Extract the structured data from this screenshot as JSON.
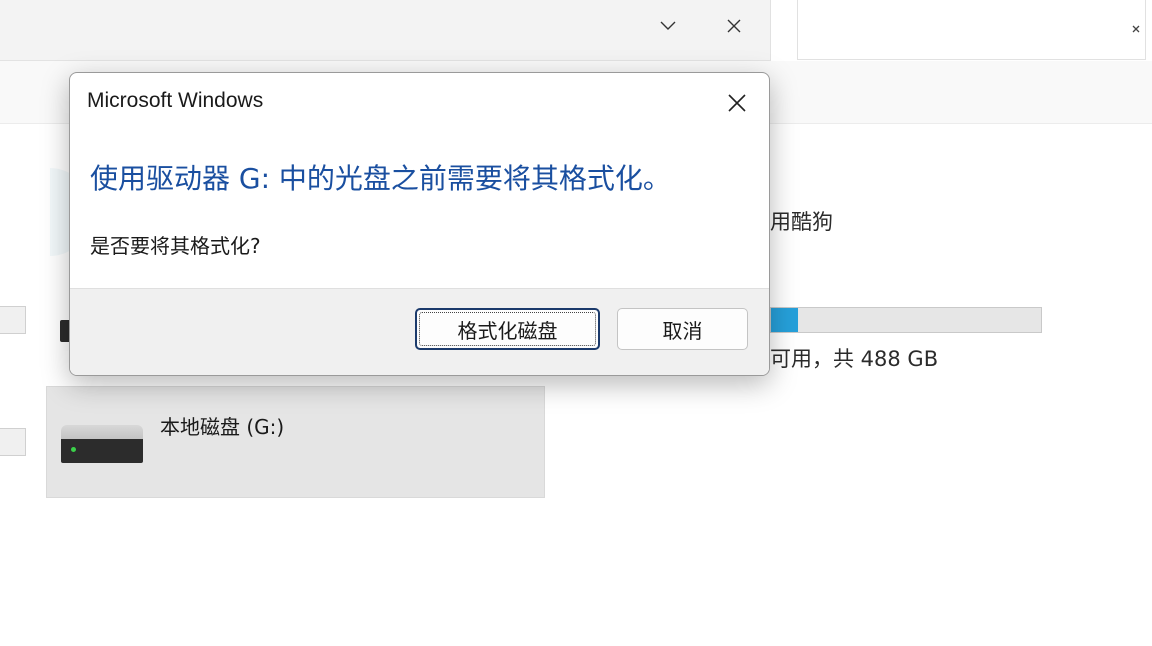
{
  "window_controls": {
    "minimize_glyph": "⌄",
    "close_glyph": "✕"
  },
  "explorer": {
    "drive_g_name": "本地磁盘 (G:)",
    "right_label_partial": "用酷狗",
    "usage_text_partial": "可用，共 488 GB",
    "usage_fraction": 0.1
  },
  "dialog": {
    "title": "Microsoft Windows",
    "main_instruction": "使用驱动器 G: 中的光盘之前需要将其格式化。",
    "content": "是否要将其格式化?",
    "buttons": {
      "format": "格式化磁盘",
      "cancel": "取消"
    }
  },
  "colors": {
    "accent": "#1a4fa0",
    "usage_fill": "#26a0da",
    "led": "#3bd14a"
  }
}
